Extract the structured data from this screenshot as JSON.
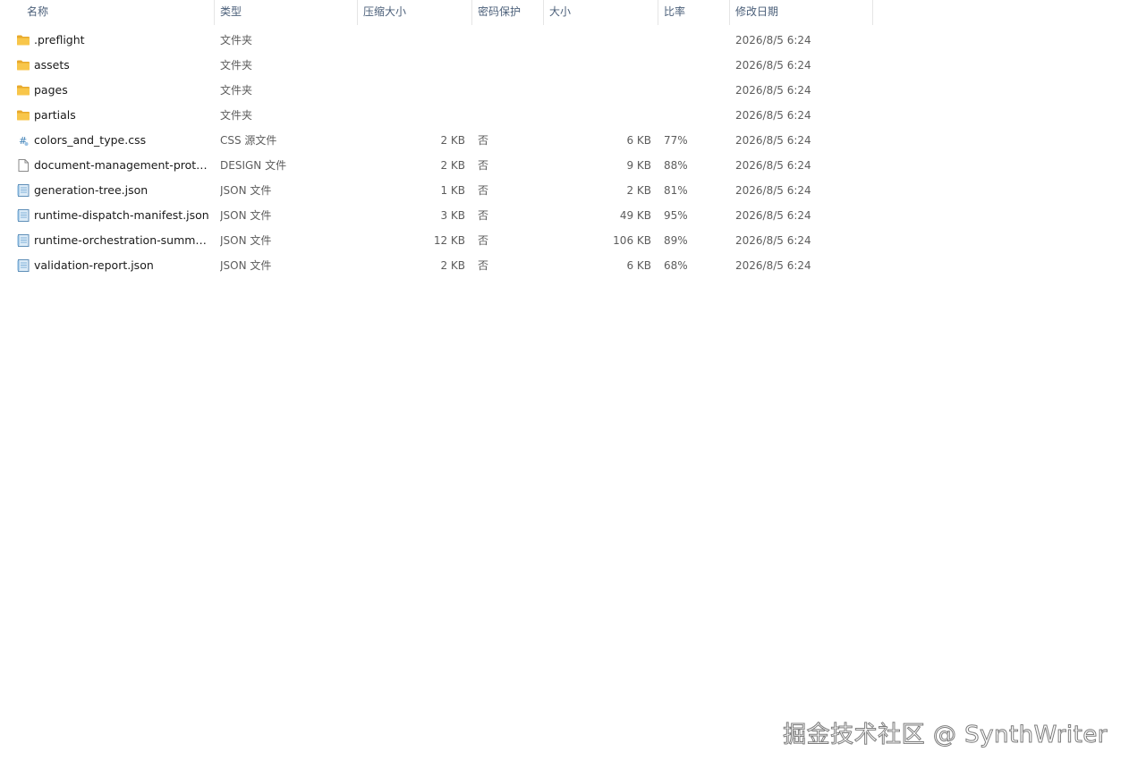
{
  "columns": {
    "name": "名称",
    "type": "类型",
    "compressed_size": "压缩大小",
    "password": "密码保护",
    "size": "大小",
    "ratio": "比率",
    "modified": "修改日期"
  },
  "sort_indicator": "^",
  "files": [
    {
      "icon": "folder-icon",
      "name": ".preflight",
      "type": "文件夹",
      "compressed_size": "",
      "password": "",
      "size": "",
      "ratio": "",
      "modified": "2026/8/5 6:24"
    },
    {
      "icon": "folder-icon",
      "name": "assets",
      "type": "文件夹",
      "compressed_size": "",
      "password": "",
      "size": "",
      "ratio": "",
      "modified": "2026/8/5 6:24"
    },
    {
      "icon": "folder-icon",
      "name": "pages",
      "type": "文件夹",
      "compressed_size": "",
      "password": "",
      "size": "",
      "ratio": "",
      "modified": "2026/8/5 6:24"
    },
    {
      "icon": "folder-icon",
      "name": "partials",
      "type": "文件夹",
      "compressed_size": "",
      "password": "",
      "size": "",
      "ratio": "",
      "modified": "2026/8/5 6:24"
    },
    {
      "icon": "css-file-icon",
      "name": "colors_and_type.css",
      "type": "CSS 源文件",
      "compressed_size": "2 KB",
      "password": "否",
      "size": "6 KB",
      "ratio": "77%",
      "modified": "2026/8/5 6:24"
    },
    {
      "icon": "blank-file-icon",
      "name": "document-management-protot...",
      "type": "DESIGN 文件",
      "compressed_size": "2 KB",
      "password": "否",
      "size": "9 KB",
      "ratio": "88%",
      "modified": "2026/8/5 6:24"
    },
    {
      "icon": "json-file-icon",
      "name": "generation-tree.json",
      "type": "JSON 文件",
      "compressed_size": "1 KB",
      "password": "否",
      "size": "2 KB",
      "ratio": "81%",
      "modified": "2026/8/5 6:24"
    },
    {
      "icon": "json-file-icon",
      "name": "runtime-dispatch-manifest.json",
      "type": "JSON 文件",
      "compressed_size": "3 KB",
      "password": "否",
      "size": "49 KB",
      "ratio": "95%",
      "modified": "2026/8/5 6:24"
    },
    {
      "icon": "json-file-icon",
      "name": "runtime-orchestration-summary...",
      "type": "JSON 文件",
      "compressed_size": "12 KB",
      "password": "否",
      "size": "106 KB",
      "ratio": "89%",
      "modified": "2026/8/5 6:24"
    },
    {
      "icon": "json-file-icon",
      "name": "validation-report.json",
      "type": "JSON 文件",
      "compressed_size": "2 KB",
      "password": "否",
      "size": "6 KB",
      "ratio": "68%",
      "modified": "2026/8/5 6:24"
    }
  ],
  "watermark": "掘金技术社区 @ SynthWriter",
  "colors": {
    "header_text": "#4c607a",
    "folder_yellow": "#f8c64a",
    "folder_dark": "#e8a92b",
    "json_blue": "#7fb0d8"
  }
}
